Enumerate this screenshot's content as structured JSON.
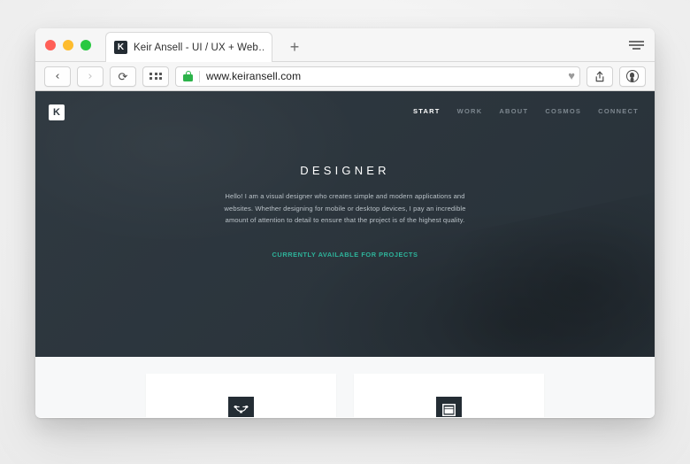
{
  "browser": {
    "traffic_lights": [
      "close",
      "minimize",
      "zoom"
    ],
    "tab": {
      "favicon_letter": "K",
      "favicon_icon": "k-monogram-favicon",
      "title": "Keir Ansell - UI / UX + Web…"
    },
    "new_tab_label": "+",
    "window_menu_icon": "sort-lines-icon",
    "toolbar": {
      "back_icon": "chevron-left-icon",
      "back_label": "‹",
      "forward_icon": "chevron-right-icon",
      "forward_label": "›",
      "reload_icon": "reload-icon",
      "reload_label": "⟳",
      "apps_icon": "apps-grid-icon",
      "lock_icon": "padlock-secure-icon",
      "url": "www.keiransell.com",
      "bookmark_icon": "heart-icon",
      "bookmark_label": "♥",
      "share_icon": "share-upload-icon",
      "share_label": "⇧",
      "profile_icon": "account-avatar-icon"
    }
  },
  "site": {
    "logo_letter": "K",
    "logo_icon": "k-monogram-logo",
    "nav": [
      {
        "label": "START",
        "active": true
      },
      {
        "label": "WORK",
        "active": false
      },
      {
        "label": "ABOUT",
        "active": false
      },
      {
        "label": "COSMOS",
        "active": false
      },
      {
        "label": "CONNECT",
        "active": false
      }
    ],
    "hero": {
      "title": "DESIGNER",
      "paragraph": "Hello! I am a visual designer who creates simple and modern applications and websites. Whether designing for mobile or desktop devices, I pay an incredible amount of attention to detail to ensure that the project is of the highest quality.",
      "availability": "CURRENTLY AVAILABLE FOR PROJECTS"
    },
    "cards": [
      {
        "icon": "bezier-curve-icon"
      },
      {
        "icon": "browser-window-icon"
      }
    ]
  },
  "colors": {
    "hero_background": "#2b353d",
    "accent_teal": "#2eb39a",
    "nav_inactive": "#7d878f",
    "nav_active": "#ffffff",
    "icon_tile": "#242d34",
    "page_light": "#f7f8f9",
    "lock_green": "#2cb34a"
  }
}
